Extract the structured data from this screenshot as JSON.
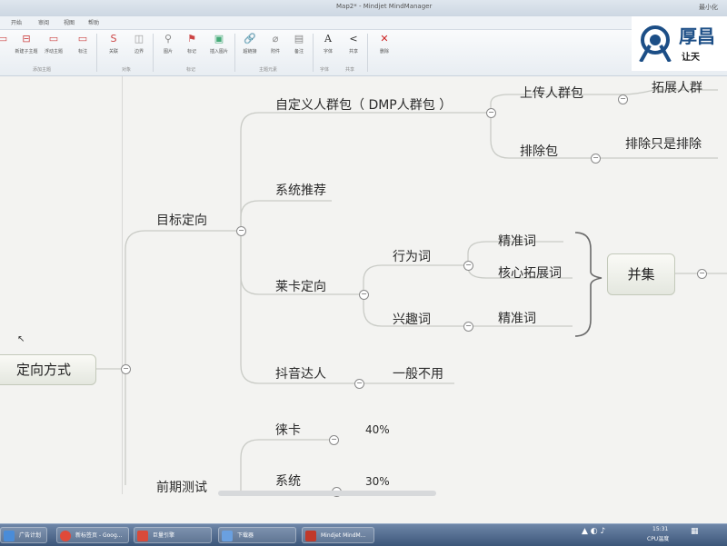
{
  "window": {
    "title": "Map2* - Mindjet MindManager",
    "minimize_label": "最小化"
  },
  "menu": [
    "开始",
    "审阅",
    "视图",
    "帮助"
  ],
  "ribbon": {
    "buttons": [
      {
        "label": "",
        "icon": "topic-icon"
      },
      {
        "label": "新建子主题",
        "icon": "subtopic-icon"
      },
      {
        "label": "浮动主题",
        "icon": "floating-topic-icon"
      },
      {
        "label": "标注",
        "icon": "callout-icon"
      },
      {
        "label": "关联",
        "icon": "relationship-icon"
      },
      {
        "label": "边界",
        "icon": "boundary-icon"
      },
      {
        "label": "图片",
        "icon": "image-icon"
      },
      {
        "label": "标记",
        "icon": "marker-icon"
      },
      {
        "label": "插入图片",
        "icon": "insert-image-icon"
      },
      {
        "label": "超链接",
        "icon": "hyperlink-icon"
      },
      {
        "label": "附件",
        "icon": "attachment-icon"
      },
      {
        "label": "备注",
        "icon": "notes-icon"
      },
      {
        "label": "字体",
        "icon": "font-icon"
      },
      {
        "label": "共享",
        "icon": "share-icon"
      },
      {
        "label": "删除",
        "icon": "delete-icon"
      }
    ],
    "groups": [
      "添加主题",
      "对象",
      "标记",
      "主题元素",
      "字体",
      "共享"
    ]
  },
  "logo": {
    "text": "厚昌",
    "slogan": "让天"
  },
  "mindmap": {
    "root": "定向方式",
    "target": "目标定向",
    "custom_pack": "自定义人群包（ DMP人群包 ）",
    "upload_pack": "上传人群包",
    "expand_audience": "拓展人群",
    "exclude_pack": "排除包",
    "exclude_only": "排除只是排除",
    "system_recommend": "系统推荐",
    "laika": "莱卡定向",
    "behavior_word": "行为词",
    "precise_word_1": "精准词",
    "core_expand_word": "核心拓展词",
    "interest_word": "兴趣词",
    "precise_word_2": "精准词",
    "union": "并集",
    "douyin_talent": "抖音达人",
    "rarely_used": "一般不用",
    "early_test": "前期测试",
    "xuka": "徕卡",
    "xuka_pct": "40%",
    "system": "系统",
    "system_pct": "30%"
  },
  "taskbar": {
    "items": [
      "广告计划",
      "新标签页 - Goog...",
      "巨量引擎",
      "下载器",
      "Mindjet MindM..."
    ],
    "clock": "15:31",
    "cpu": "CPU温度"
  }
}
